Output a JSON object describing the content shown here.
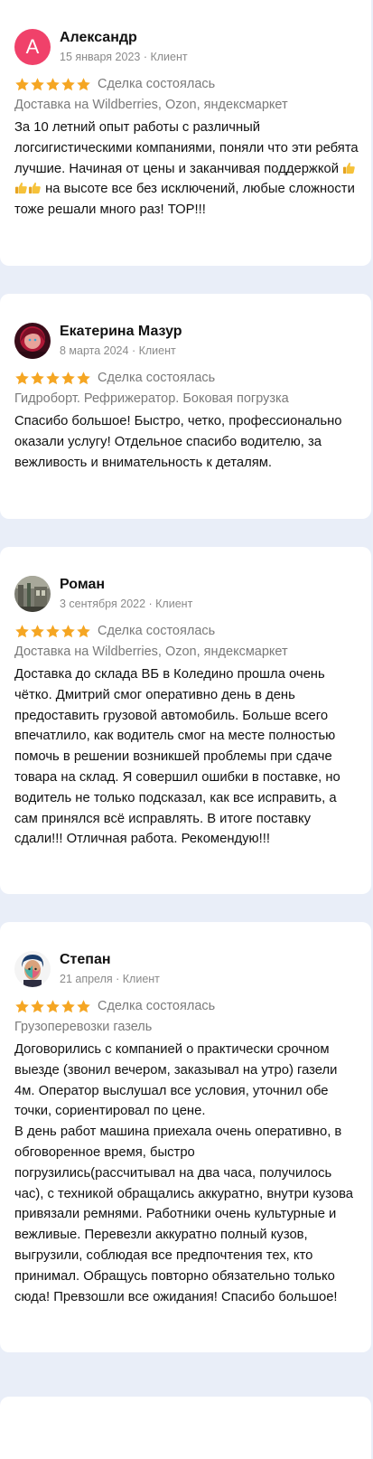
{
  "colors": {
    "background": "#e9eef8",
    "card": "#ffffff",
    "star": "#f5a623",
    "avatar_letter_bg": "#f0416a",
    "meta_text": "#8a8a8a"
  },
  "reviews": [
    {
      "avatar_letter": "А",
      "name": "Александр",
      "meta": "15 января 2023 · Клиент",
      "rating": 5,
      "deal": "Сделка состоялась",
      "category": "Доставка на Wildberries, Ozon, яндексмаркет",
      "text_before": "За 10 летний опыт работы с различный логсигистическими компаниями, поняли что эти ребята лучшие. Начиная от цены и заканчивая поддержкой ",
      "emoji": "👍👍👍",
      "text_after": " на высоте все без исключений, любые сложности тоже решали много раз! ТОР!!!"
    },
    {
      "name": "Екатерина Мазур",
      "meta": "8 марта 2024 · Клиент",
      "rating": 5,
      "deal": "Сделка состоялась",
      "category": "Гидроборт. Рефрижератор. Боковая погрузка",
      "text": "Спасибо большое! Быстро, четко, профессионально оказали услугу! Отдельное спасибо водителю, за вежливость и внимательность к деталям."
    },
    {
      "name": "Роман",
      "meta": "3 сентября 2022 · Клиент",
      "rating": 5,
      "deal": "Сделка состоялась",
      "category": "Доставка на Wildberries, Ozon, яндексмаркет",
      "text": "Доставка до склада ВБ в Коледино прошла очень чётко. Дмитрий смог оперативно день в день предоставить грузовой автомобиль. Больше всего впечатлило, как водитель смог на месте полностью помочь в решении возникшей проблемы при сдаче товара на склад. Я совершил ошибки в поставке, но водитель не только подсказал, как все исправить, а сам принялся всё исправлять. В итоге поставку сдали!!! Отличная работа. Рекомендую!!!"
    },
    {
      "name": "Степан",
      "meta": "21 апреля · Клиент",
      "rating": 5,
      "deal": "Сделка состоялась",
      "category": "Грузоперевозки газель",
      "text": "Договорились с компанией о практически срочном выезде (звонил вечером, заказывал на утро) газели 4м. Оператор выслушал все условия, уточнил обе точки, сориентировал по цене.\nВ день работ машина приехала очень оперативно, в обговоренное время, быстро погрузились(рассчитывал на два часа, получилось час), с техникой обращались аккуратно, внутри кузова привязали ремнями. Работники очень культурные и вежливые. Перевезли аккуратно полный кузов, выгрузили, соблюдая все предпочтения тех, кто принимал. Обращусь повторно обязательно только сюда! Превзошли все ожидания! Спасибо большое!"
    }
  ]
}
